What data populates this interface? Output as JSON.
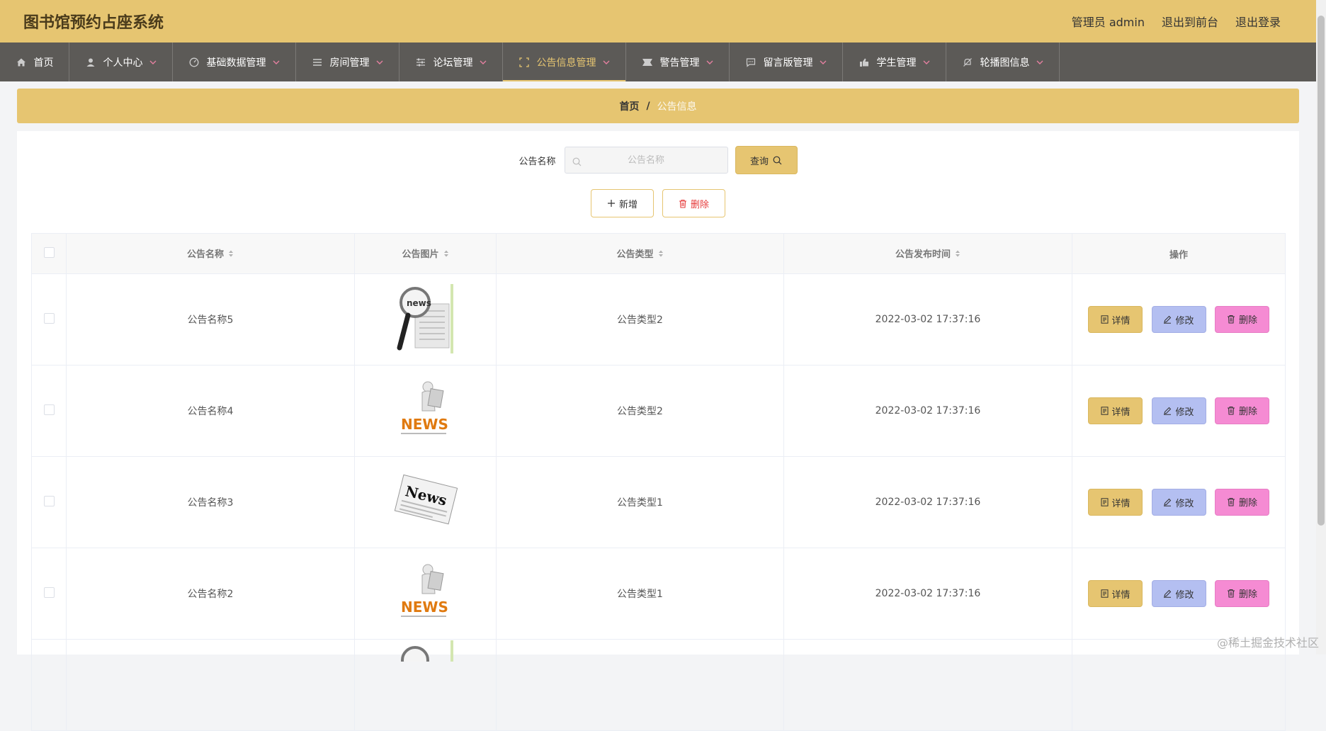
{
  "header": {
    "app_title": "图书馆预约占座系统",
    "user_label": "管理员 admin",
    "to_front_label": "退出到前台",
    "logout_label": "退出登录"
  },
  "nav": {
    "items": [
      {
        "label": "首页",
        "icon": "home-icon"
      },
      {
        "label": "个人中心",
        "icon": "user-icon"
      },
      {
        "label": "基础数据管理",
        "icon": "gauge-icon"
      },
      {
        "label": "房间管理",
        "icon": "list-icon"
      },
      {
        "label": "论坛管理",
        "icon": "sliders-icon"
      },
      {
        "label": "公告信息管理",
        "icon": "fullscreen-icon",
        "active": true
      },
      {
        "label": "警告管理",
        "icon": "ticket-icon"
      },
      {
        "label": "留言版管理",
        "icon": "chat-icon"
      },
      {
        "label": "学生管理",
        "icon": "thumb-icon"
      },
      {
        "label": "轮播图信息",
        "icon": "bell-off-icon"
      }
    ]
  },
  "breadcrumb": {
    "home": "首页",
    "separator": "/",
    "current": "公告信息"
  },
  "search": {
    "label": "公告名称",
    "placeholder": "公告名称",
    "query_label": "查询"
  },
  "actions": {
    "add_label": "新增",
    "delete_label": "删除"
  },
  "table": {
    "columns": [
      "公告名称",
      "公告图片",
      "公告类型",
      "公告发布时间",
      "操作"
    ],
    "rows": [
      {
        "name": "公告名称5",
        "image": "news-magnifier-image",
        "type": "公告类型2",
        "time": "2022-03-02 17:37:16"
      },
      {
        "name": "公告名称4",
        "image": "news-figure-image",
        "type": "公告类型2",
        "time": "2022-03-02 17:37:16"
      },
      {
        "name": "公告名称3",
        "image": "news-paper-image",
        "type": "公告类型1",
        "time": "2022-03-02 17:37:16"
      },
      {
        "name": "公告名称2",
        "image": "news-figure-image",
        "type": "公告类型1",
        "time": "2022-03-02 17:37:16"
      }
    ],
    "row_actions": {
      "detail": "详情",
      "edit": "修改",
      "delete": "删除"
    }
  },
  "watermark": "@稀土掘金技术社区",
  "colors": {
    "accent": "#e6c571",
    "nav_bg": "#5c5a57",
    "edit_btn": "#b4bff1",
    "delete_btn": "#f58bd3",
    "danger_text": "#e63b3b"
  }
}
